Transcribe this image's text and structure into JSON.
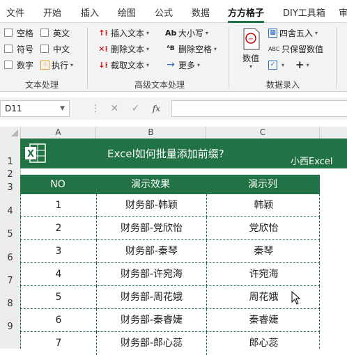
{
  "ribbon_tabs": [
    "文件",
    "开始",
    "插入",
    "绘图",
    "公式",
    "数据",
    "方方格子",
    "DIY工具箱",
    "审"
  ],
  "active_tab": "方方格子",
  "text_group": {
    "checkboxes": [
      "空格",
      "英文",
      "符号",
      "中文",
      "数字"
    ],
    "exec_label": "执行",
    "group_label": "文本处理"
  },
  "advanced_group": {
    "insert_text": "插入文本",
    "delete_text": "删除文本",
    "extract_text": "截取文本",
    "case": "大小写",
    "delete_spaces": "删除空格",
    "more": "更多",
    "group_label": "高级文本处理"
  },
  "number_group": {
    "value_label": "数值",
    "round": "四舍五入",
    "keep_value": "只保留数值",
    "plus": "+",
    "group_label": "数据录入"
  },
  "formula_bar": {
    "cell_ref": "D11",
    "fx": "fx",
    "content": ""
  },
  "columns": [
    "A",
    "B",
    "C"
  ],
  "rows": [
    "1",
    "2",
    "3",
    "4",
    "5",
    "6",
    "7",
    "8",
    "9"
  ],
  "banner": {
    "title": "Excel如何批量添加前缀?",
    "author": "小西Excel"
  },
  "table": {
    "headers": [
      "NO",
      "演示效果",
      "演示列"
    ],
    "rows": [
      {
        "no": "1",
        "effect": "财务部-韩颖",
        "name": "韩颖"
      },
      {
        "no": "2",
        "effect": "财务部-党欣怡",
        "name": "党欣怡"
      },
      {
        "no": "3",
        "effect": "财务部-秦琴",
        "name": "秦琴"
      },
      {
        "no": "4",
        "effect": "财务部-许宛海",
        "name": "许宛海"
      },
      {
        "no": "5",
        "effect": "财务部-周花娥",
        "name": "周花娥"
      },
      {
        "no": "6",
        "effect": "财务部-秦睿婕",
        "name": "秦睿婕"
      },
      {
        "no": "7",
        "effect": "财务部-郎心蕊",
        "name": "郎心蕊"
      }
    ]
  },
  "colors": {
    "accent": "#217346",
    "ribbon_bg": "#f3f3f3"
  }
}
